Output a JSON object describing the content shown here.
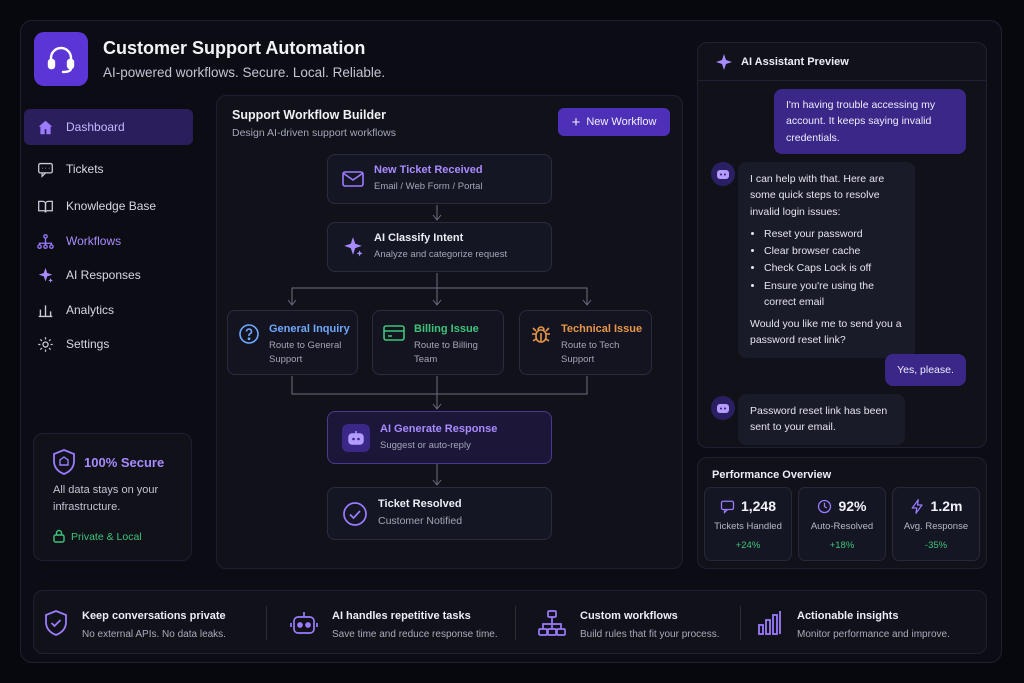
{
  "header": {
    "title": "Customer Support Automation",
    "subtitle": "AI-powered workflows. Secure. Local. Reliable."
  },
  "sidebar": {
    "items": [
      {
        "label": "Dashboard",
        "icon": "home-icon"
      },
      {
        "label": "Tickets",
        "icon": "chat-icon"
      },
      {
        "label": "Knowledge Base",
        "icon": "book-icon"
      },
      {
        "label": "Workflows",
        "icon": "workflow-icon"
      },
      {
        "label": "AI Responses",
        "icon": "sparkle-icon"
      },
      {
        "label": "Analytics",
        "icon": "bar-chart-icon"
      },
      {
        "label": "Settings",
        "icon": "gear-icon"
      }
    ]
  },
  "secure": {
    "title": "100% Secure",
    "text": "All data stays on your infrastructure.",
    "badge": "Private & Local"
  },
  "workflow": {
    "title": "Support Workflow Builder",
    "subtitle": "Design AI-driven support workflows",
    "new_button": "New Workflow",
    "nodes": {
      "received": {
        "title": "New Ticket Received",
        "sub": "Email / Web Form / Portal"
      },
      "classify": {
        "title": "AI Classify Intent",
        "sub": "Analyze and categorize request"
      },
      "general": {
        "title": "General Inquiry",
        "sub": "Route to General Support"
      },
      "billing": {
        "title": "Billing Issue",
        "sub": "Route to Billing Team"
      },
      "technical": {
        "title": "Technical Issue",
        "sub": "Route to Tech Support"
      },
      "generate": {
        "title": "AI Generate Response",
        "sub": "Suggest or auto-reply"
      },
      "resolved": {
        "title": "Ticket Resolved",
        "sub": "Customer Notified"
      }
    }
  },
  "chat": {
    "title": "AI Assistant Preview",
    "user_msg_1": "I'm having trouble accessing my account. It keeps saying invalid credentials.",
    "ai_intro": "I can help with that. Here are some quick steps to resolve invalid login issues:",
    "ai_steps": [
      "Reset your password",
      "Clear browser cache",
      "Check Caps Lock is off",
      "Ensure you're using the correct email"
    ],
    "ai_question": "Would you like me to send you a password reset link?",
    "user_msg_2": "Yes, please.",
    "ai_msg_2": "Password reset link has been sent to your email."
  },
  "performance": {
    "title": "Performance Overview",
    "stats": [
      {
        "value": "1,248",
        "label": "Tickets Handled",
        "change": "+24%"
      },
      {
        "value": "92%",
        "label": "Auto-Resolved",
        "change": "+18%"
      },
      {
        "value": "1.2m",
        "label": "Avg. Response",
        "change": "-35%"
      }
    ]
  },
  "features": [
    {
      "title": "Keep conversations private",
      "sub": "No external APIs. No data leaks."
    },
    {
      "title": "AI handles repetitive tasks",
      "sub": "Save time and reduce response time."
    },
    {
      "title": "Custom workflows",
      "sub": "Build rules that fit your process."
    },
    {
      "title": "Actionable insights",
      "sub": "Monitor performance and improve."
    }
  ],
  "colors": {
    "accent": "#5b35d5",
    "billing": "#3ec47a",
    "technical": "#e8964a",
    "general": "#6fa8ff"
  }
}
